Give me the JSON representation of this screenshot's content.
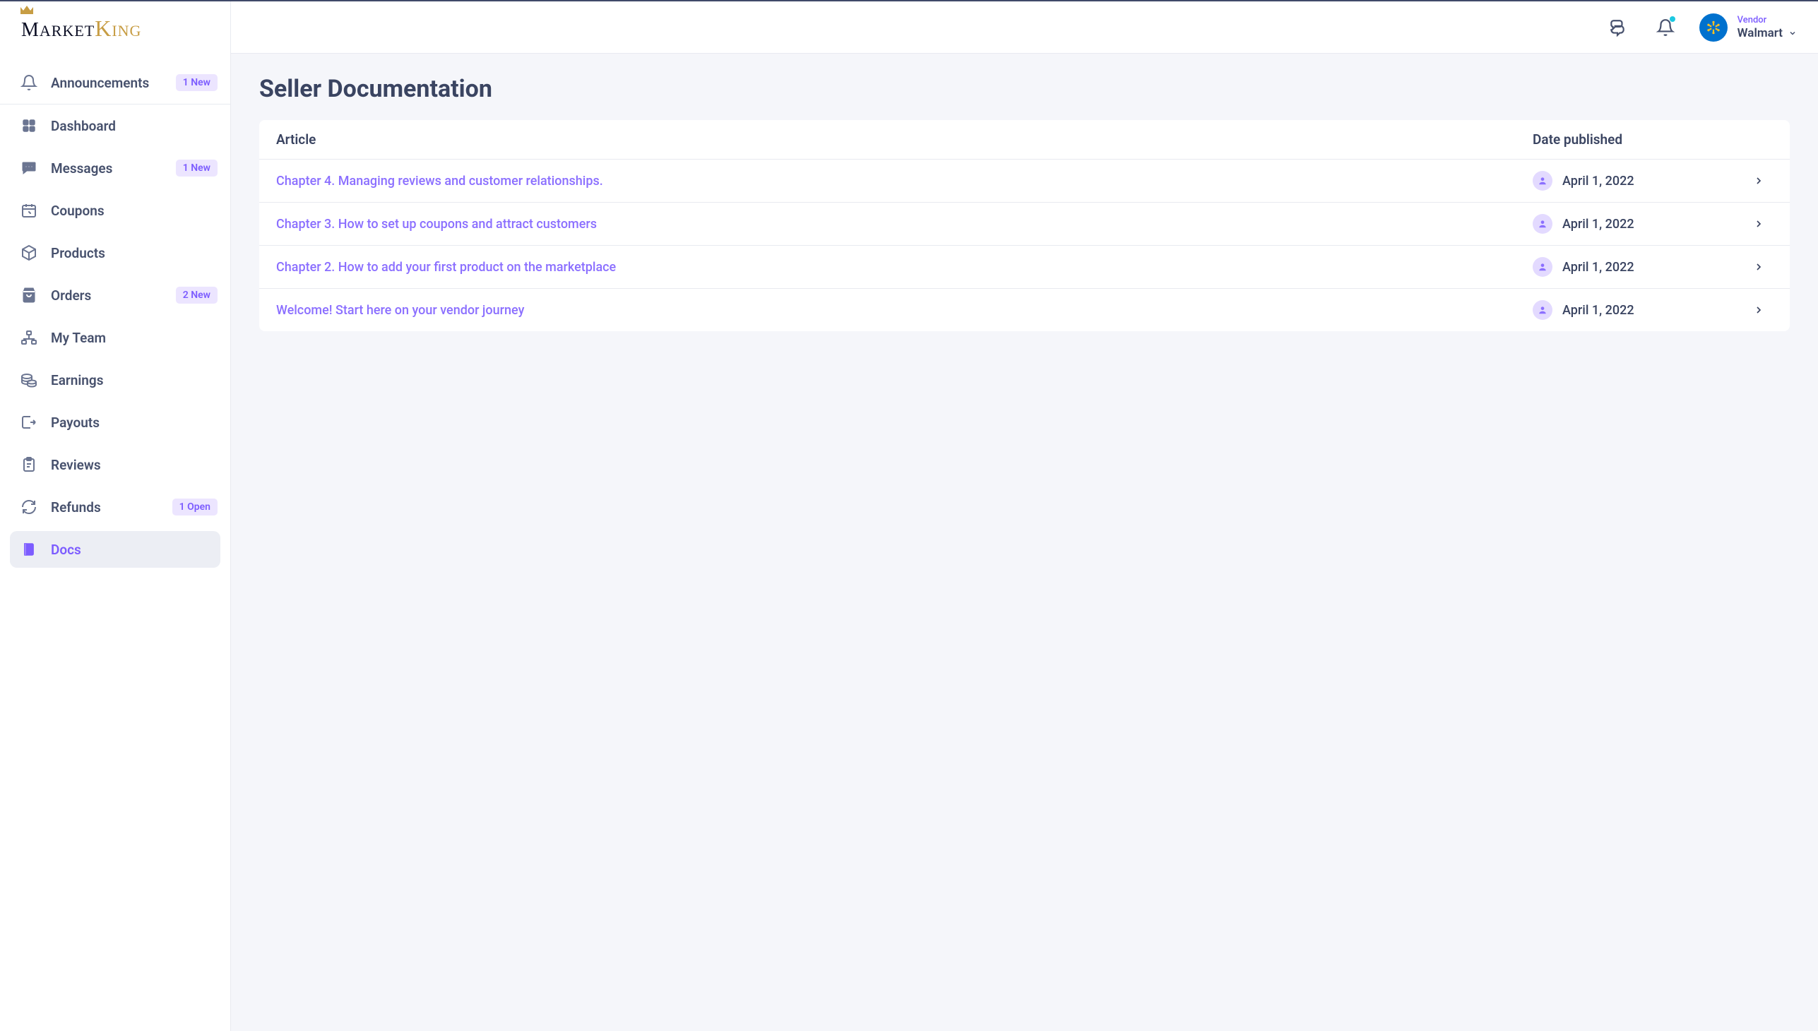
{
  "brand": {
    "text_market": "MARKET",
    "text_king": "KING"
  },
  "sidebar": {
    "announcements": {
      "label": "Announcements",
      "badge": "1 New"
    },
    "items": [
      {
        "key": "dashboard",
        "label": "Dashboard",
        "badge": ""
      },
      {
        "key": "messages",
        "label": "Messages",
        "badge": "1 New"
      },
      {
        "key": "coupons",
        "label": "Coupons",
        "badge": ""
      },
      {
        "key": "products",
        "label": "Products",
        "badge": ""
      },
      {
        "key": "orders",
        "label": "Orders",
        "badge": "2 New"
      },
      {
        "key": "my-team",
        "label": "My Team",
        "badge": ""
      },
      {
        "key": "earnings",
        "label": "Earnings",
        "badge": ""
      },
      {
        "key": "payouts",
        "label": "Payouts",
        "badge": ""
      },
      {
        "key": "reviews",
        "label": "Reviews",
        "badge": ""
      },
      {
        "key": "refunds",
        "label": "Refunds",
        "badge": "1 Open"
      },
      {
        "key": "docs",
        "label": "Docs",
        "badge": ""
      }
    ]
  },
  "topbar": {
    "vendor_role": "Vendor",
    "vendor_name": "Walmart"
  },
  "page": {
    "title": "Seller Documentation",
    "col_article": "Article",
    "col_date": "Date published",
    "rows": [
      {
        "title": "Chapter 4. Managing reviews and customer relationships.",
        "date": "April 1, 2022"
      },
      {
        "title": "Chapter 3. How to set up coupons and attract customers",
        "date": "April 1, 2022"
      },
      {
        "title": "Chapter 2. How to add your first product on the marketplace",
        "date": "April 1, 2022"
      },
      {
        "title": "Welcome! Start here on your vendor journey",
        "date": "April 1, 2022"
      }
    ]
  }
}
